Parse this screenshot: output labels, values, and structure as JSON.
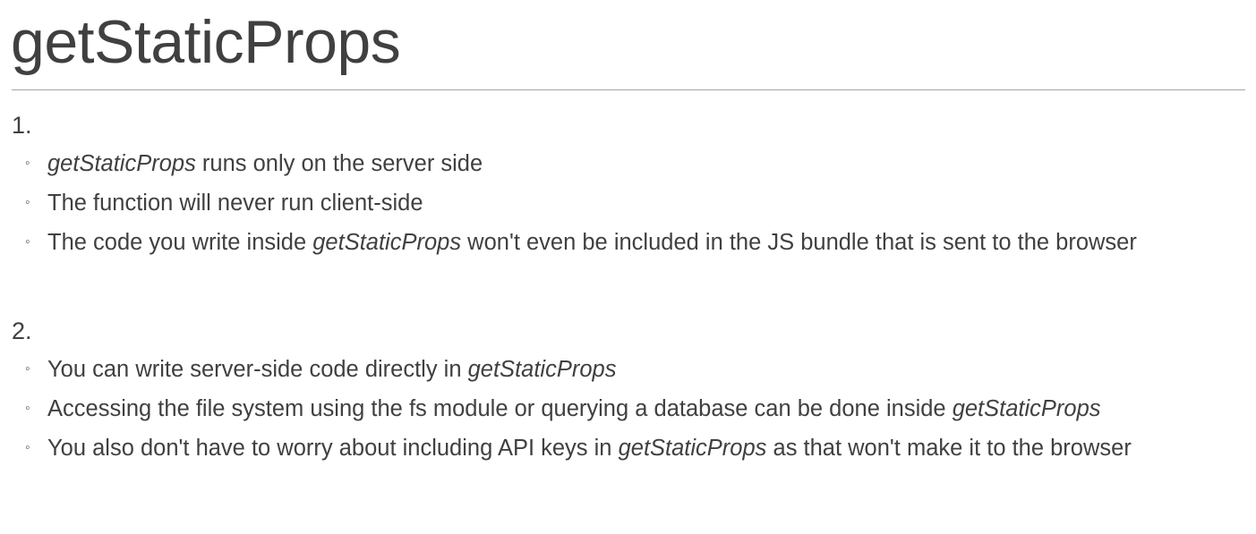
{
  "title": "getStaticProps",
  "sections": [
    {
      "number": "1.",
      "items": [
        {
          "parts": [
            {
              "text": "getStaticProps",
              "italic": true
            },
            {
              "text": " runs only on the server side",
              "italic": false
            }
          ]
        },
        {
          "parts": [
            {
              "text": "The function will never run client-side",
              "italic": false
            }
          ]
        },
        {
          "parts": [
            {
              "text": "The code you write inside ",
              "italic": false
            },
            {
              "text": "getStaticProps",
              "italic": true
            },
            {
              "text": " won't even be included in the JS bundle that is sent to the browser",
              "italic": false
            }
          ]
        }
      ]
    },
    {
      "number": "2.",
      "items": [
        {
          "parts": [
            {
              "text": "You can write server-side code directly in ",
              "italic": false
            },
            {
              "text": "getStaticProps",
              "italic": true
            }
          ]
        },
        {
          "parts": [
            {
              "text": "Accessing the file system using the fs module or querying a database can be done inside ",
              "italic": false
            },
            {
              "text": "getStaticProps",
              "italic": true
            }
          ]
        },
        {
          "parts": [
            {
              "text": "You also don't have to worry about including API keys in ",
              "italic": false
            },
            {
              "text": "getStaticProps",
              "italic": true
            },
            {
              "text": " as that won't make it to the browser",
              "italic": false
            }
          ]
        }
      ]
    }
  ],
  "bullet_glyph": "◦",
  "colors": {
    "text": "#404040",
    "rule": "#a6a6a6",
    "background": "#ffffff"
  }
}
